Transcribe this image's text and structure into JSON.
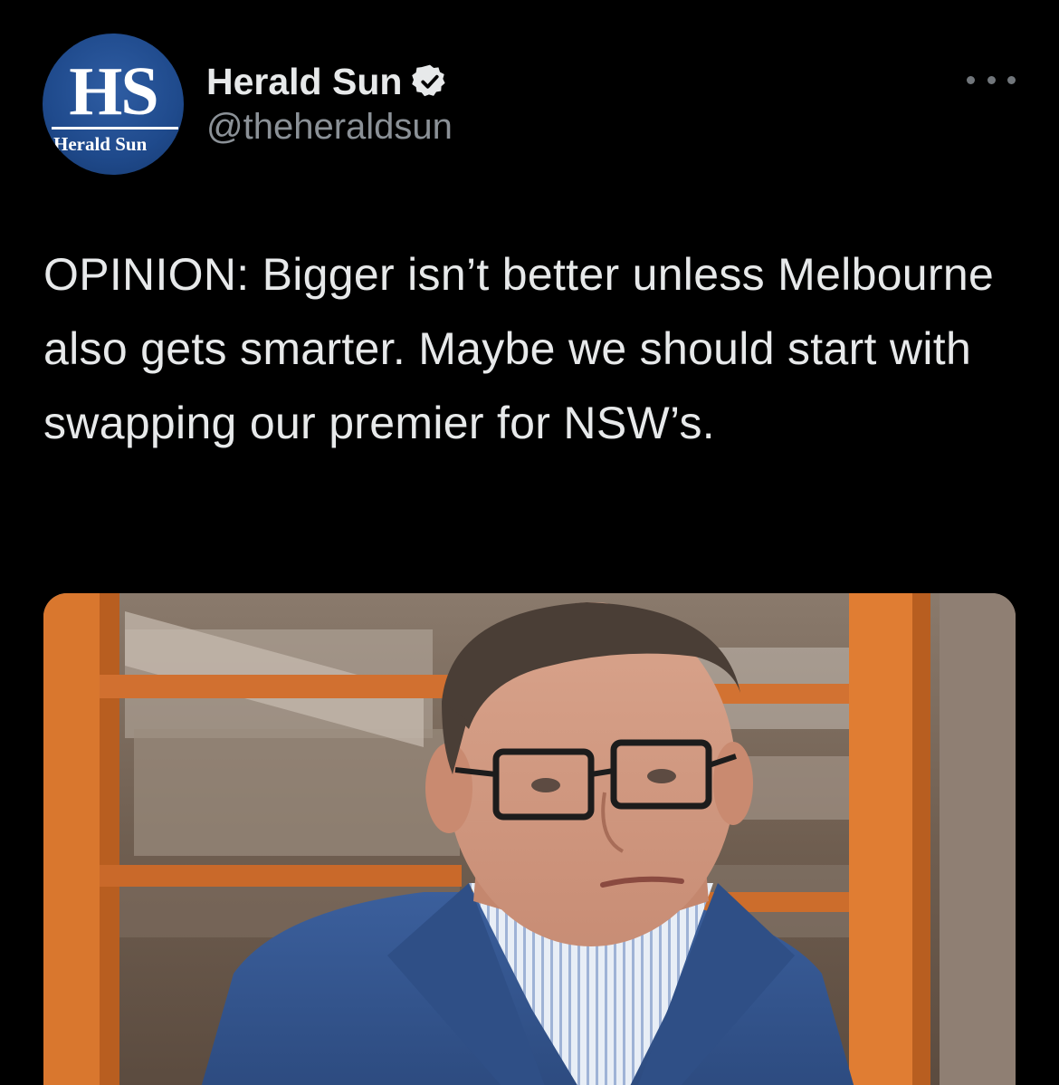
{
  "account": {
    "display_name": "Herald Sun",
    "handle": "@theheraldsun",
    "verified": true,
    "avatar": {
      "monogram": "HS",
      "wordmark": "Herald Sun",
      "color": "#1f4a8c"
    }
  },
  "menu": {
    "icon": "more-horizontal-icon"
  },
  "tweet": {
    "text": "OPINION: Bigger isn’t better unless Melbourne also gets smarter. Maybe we should start with swapping our premier for NSW’s."
  },
  "media": {
    "icon": "photo"
  },
  "colors": {
    "background": "#000000",
    "text": "#e7e9ea",
    "secondary_text": "#8b9197",
    "verified_badge": "#e7e9ea"
  }
}
